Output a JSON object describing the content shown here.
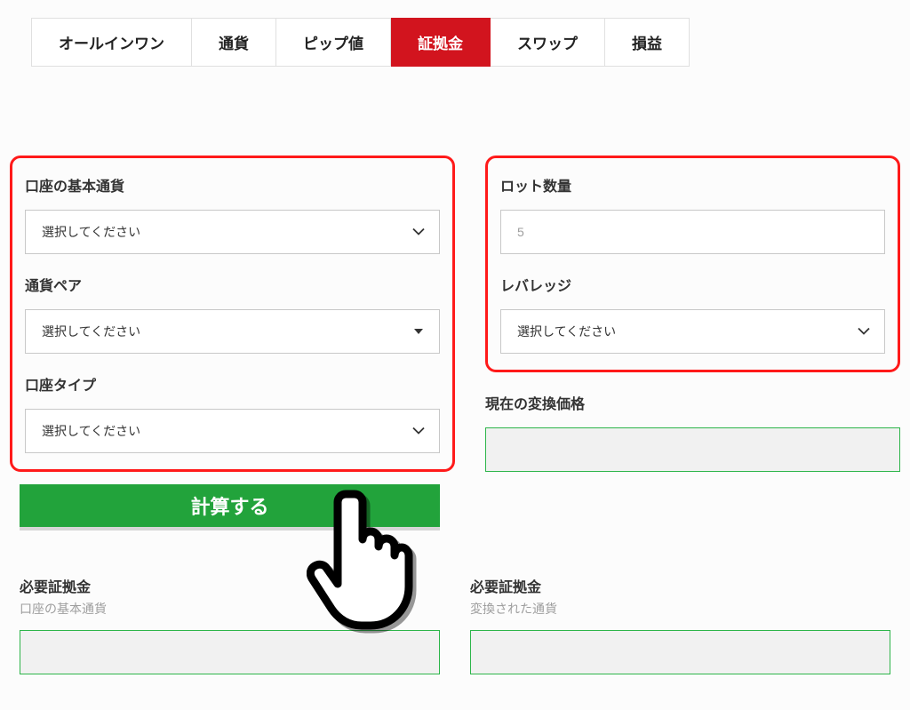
{
  "tabs": [
    {
      "label": "オールインワン"
    },
    {
      "label": "通貨"
    },
    {
      "label": "ピップ値"
    },
    {
      "label": "証拠金"
    },
    {
      "label": "スワップ"
    },
    {
      "label": "損益"
    }
  ],
  "active_tab_index": 3,
  "left": {
    "base_currency_label": "口座の基本通貨",
    "pair_label": "通貨ペア",
    "account_type_label": "口座タイプ",
    "select_placeholder": "選択してください"
  },
  "right": {
    "lot_label": "ロット数量",
    "lot_placeholder": "5",
    "leverage_label": "レバレッジ",
    "select_placeholder": "選択してください",
    "conv_rate_label": "現在の変換価格"
  },
  "calc_button": "計算する",
  "results": {
    "left_title": "必要証拠金",
    "left_sub": "口座の基本通貨",
    "right_title": "必要証拠金",
    "right_sub": "変換された通貨"
  }
}
